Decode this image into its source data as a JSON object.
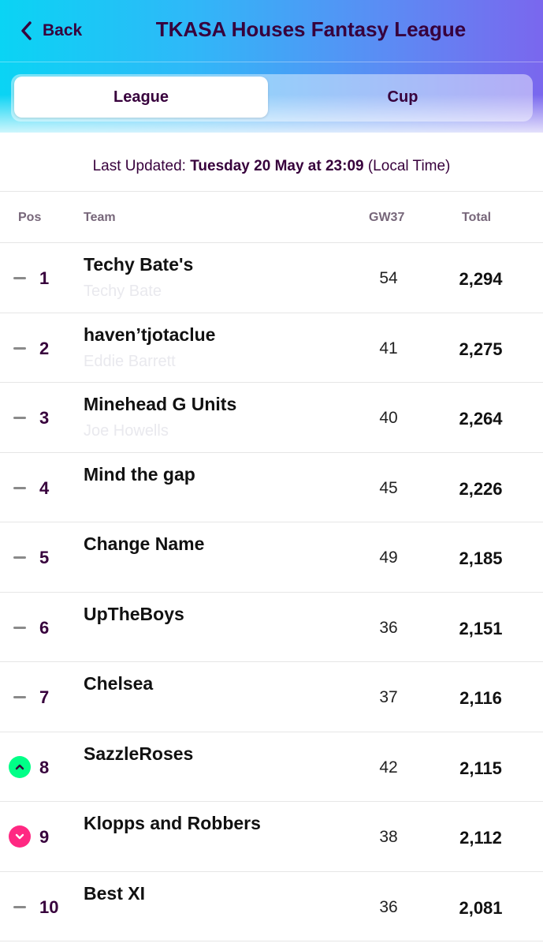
{
  "header": {
    "back_label": "Back",
    "title": "TKASA Houses Fantasy League",
    "tabs": [
      "League",
      "Cup"
    ],
    "active_tab": "League"
  },
  "updated": {
    "prefix": "Last Updated: ",
    "datetime": "Tuesday 20 May at 23:09",
    "suffix": " (Local Time)"
  },
  "table": {
    "columns": {
      "pos": "Pos",
      "team": "Team",
      "gw": "GW37",
      "total": "Total"
    },
    "rows": [
      {
        "movement": "same",
        "pos": "1",
        "team": "Techy Bate's",
        "manager": "Techy Bate",
        "gw": "54",
        "total": "2,294"
      },
      {
        "movement": "same",
        "pos": "2",
        "team": "haven’tjotaclue",
        "manager": "Eddie Barrett",
        "gw": "41",
        "total": "2,275"
      },
      {
        "movement": "same",
        "pos": "3",
        "team": "Minehead G Units",
        "manager": "Joe Howells",
        "gw": "40",
        "total": "2,264"
      },
      {
        "movement": "same",
        "pos": "4",
        "team": "Mind the gap",
        "manager": "",
        "gw": "45",
        "total": "2,226"
      },
      {
        "movement": "same",
        "pos": "5",
        "team": "Change Name",
        "manager": "",
        "gw": "49",
        "total": "2,185"
      },
      {
        "movement": "same",
        "pos": "6",
        "team": "UpTheBoys",
        "manager": "",
        "gw": "36",
        "total": "2,151"
      },
      {
        "movement": "same",
        "pos": "7",
        "team": "Chelsea",
        "manager": "",
        "gw": "37",
        "total": "2,116"
      },
      {
        "movement": "up",
        "pos": "8",
        "team": "SazzleRoses",
        "manager": "",
        "gw": "42",
        "total": "2,115"
      },
      {
        "movement": "down",
        "pos": "9",
        "team": "Klopps and Robbers",
        "manager": "",
        "gw": "38",
        "total": "2,112"
      },
      {
        "movement": "same",
        "pos": "10",
        "team": "Best XI",
        "manager": "",
        "gw": "36",
        "total": "2,081"
      }
    ]
  },
  "colors": {
    "primary": "#37003c",
    "up": "#00ff87",
    "down": "#ff2882",
    "header_start": "#0ad4f4",
    "header_end": "#7a67ee"
  },
  "icons": {
    "back": "chevron-left-icon",
    "up": "chevron-up-icon",
    "down": "chevron-down-icon",
    "same": "dash-icon"
  }
}
